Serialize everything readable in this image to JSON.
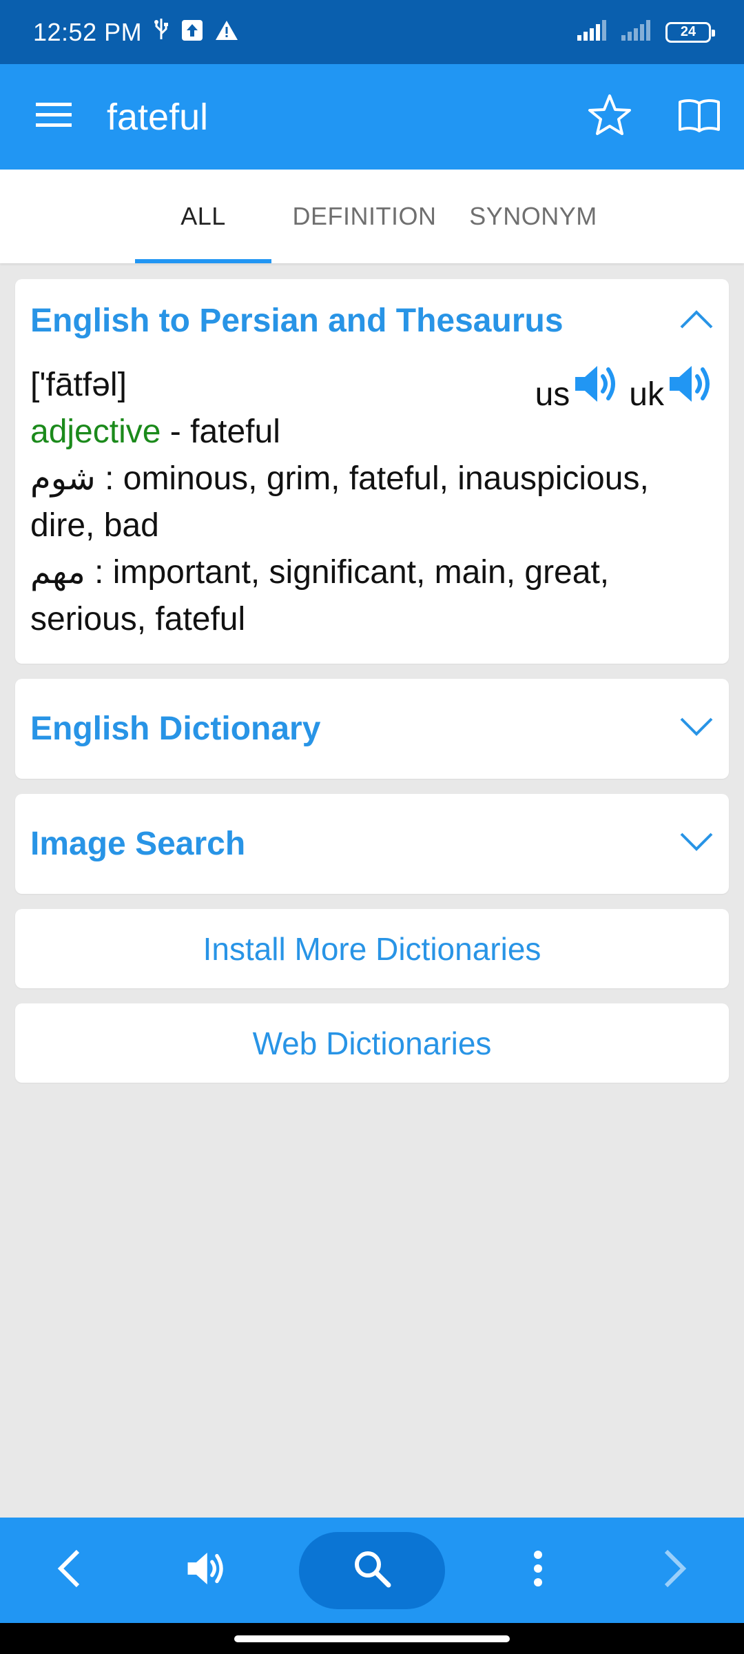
{
  "status": {
    "time": "12:52 PM",
    "battery": "24"
  },
  "app_bar": {
    "title": "fateful"
  },
  "tabs": [
    {
      "label": "ALL",
      "active": true
    },
    {
      "label": "DEFINITION",
      "active": false
    },
    {
      "label": "SYNONYM",
      "active": false
    }
  ],
  "cards": {
    "persian": {
      "title": "English to Persian and Thesaurus",
      "pronunciation": "['fātfəl]",
      "pos": "adjective",
      "pos_suffix": " - fateful",
      "lines": [
        {
          "word": "شوم",
          "text": " : ominous, grim, fateful, inauspicious, dire, bad"
        },
        {
          "word": "مهم",
          "text": " : important, significant, main, great, serious, fateful"
        }
      ],
      "audio_us": "us",
      "audio_uk": "uk"
    },
    "english": {
      "title": "English Dictionary"
    },
    "image": {
      "title": "Image Search"
    }
  },
  "buttons": {
    "install": "Install More Dictionaries",
    "web": "Web Dictionaries"
  },
  "colors": {
    "status_bar": "#0a5fae",
    "app_bar": "#2196f3",
    "accent_text": "#2894e6",
    "pos_green": "#1b8a1b",
    "search_pill": "#0b75d4"
  }
}
